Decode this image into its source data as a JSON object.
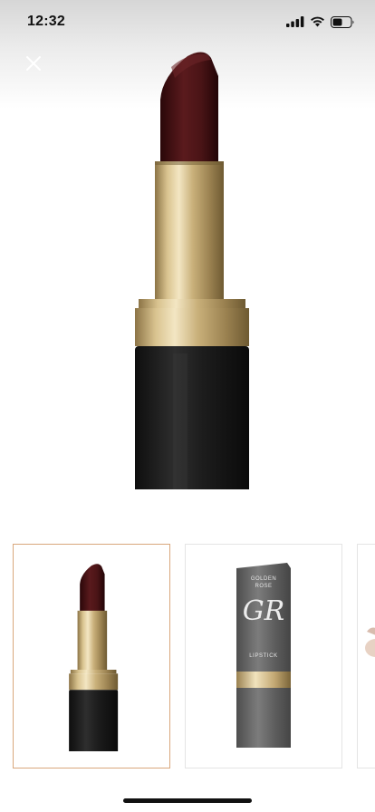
{
  "status": {
    "time": "12:32",
    "icons": [
      "cellular-signal-icon",
      "wifi-icon",
      "battery-icon"
    ]
  },
  "close_icon": "close-icon",
  "gallery": {
    "thumbnail_count_visible": 3,
    "selected_index": 0,
    "thumbnails": [
      {
        "label": "burgundy-lipstick-gold-case"
      },
      {
        "brand_line1": "GOLDEN",
        "brand_line2": "ROSE",
        "logo_text": "GR",
        "product_label": "LIPSTICK"
      },
      {
        "label": "partial-swatch"
      }
    ]
  },
  "colors": {
    "lipstick_bullet": "#4a1416",
    "gold": "#c9b07a",
    "black_case": "#1b1b1b",
    "grey_case": "#6a6a6a",
    "selected_border": "#d9a77c"
  }
}
